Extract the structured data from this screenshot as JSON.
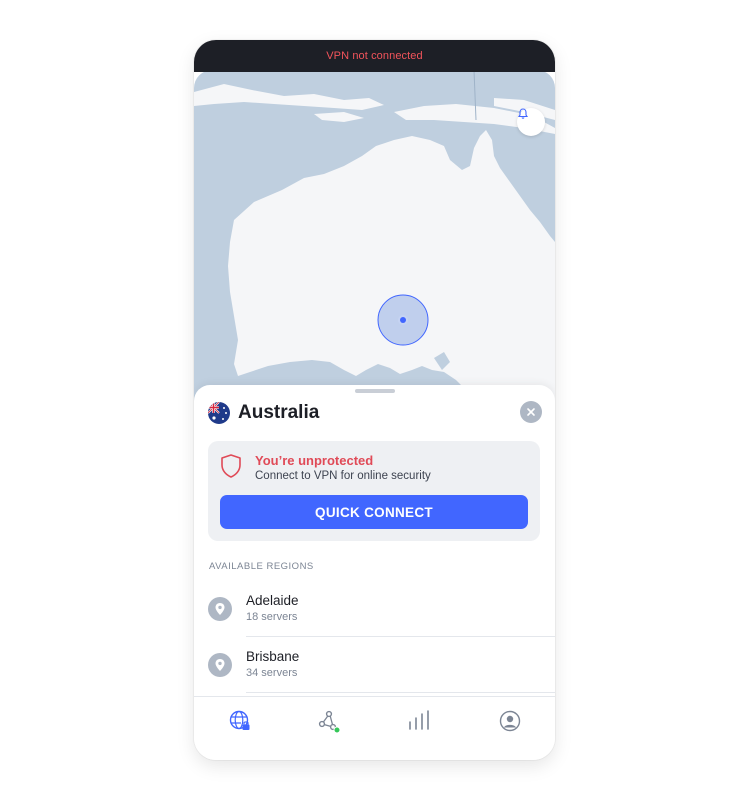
{
  "status_bar": {
    "text": "VPN not connected",
    "color": "#f2545b"
  },
  "sheet": {
    "country": "Australia",
    "flag_icon": "australia-flag-icon",
    "close_icon": "close-icon"
  },
  "status_card": {
    "title": "You’re unprotected",
    "subtitle": "Connect to VPN for online security",
    "button_label": "QUICK CONNECT",
    "accent": "#4166ff",
    "warning": "#e04a57"
  },
  "regions": {
    "label": "AVAILABLE REGIONS",
    "items": [
      {
        "name": "Adelaide",
        "servers": "18 servers"
      },
      {
        "name": "Brisbane",
        "servers": "34 servers"
      }
    ]
  },
  "nav": {
    "items": [
      {
        "icon": "globe-lock-icon",
        "active": true
      },
      {
        "icon": "meshnet-icon",
        "active": false
      },
      {
        "icon": "stats-icon",
        "active": false
      },
      {
        "icon": "profile-icon",
        "active": false
      }
    ]
  }
}
